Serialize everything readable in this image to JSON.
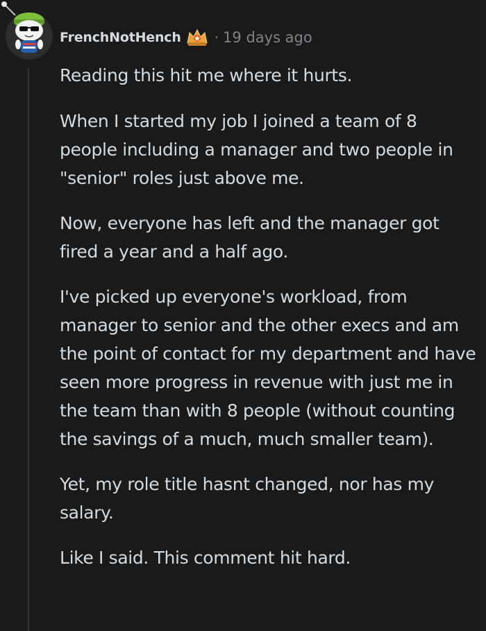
{
  "comment": {
    "author": "FrenchNotHench",
    "separator": "·",
    "timestamp": "19 days ago",
    "avatar_icon": "snoo-avatar-icon",
    "flair_icon": "crown-award-icon",
    "paragraphs": [
      "Reading this hit me where it hurts.",
      "When I started my job I joined a team of 8 people including a manager and two people in \"senior\" roles just above me.",
      "Now, everyone has left and the manager got fired a year and a half ago.",
      "I've picked up everyone's workload, from manager to senior and the other execs and am the point of contact for my department and have seen more progress in revenue with just me in the team than with 8 people (without counting the savings of a much, much smaller team).",
      "Yet, my role title hasnt changed, nor has my salary.",
      "Like I said. This comment hit hard."
    ]
  },
  "colors": {
    "background": "#1a1a1b",
    "text": "#d7dadc",
    "meta": "#818384",
    "thread_line": "#343536"
  }
}
